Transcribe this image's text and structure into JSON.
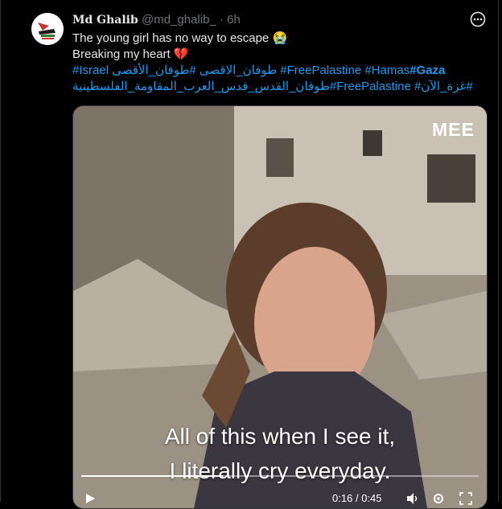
{
  "tweet": {
    "author_name": "Md Ghalib",
    "handle": "@md_ghalib_",
    "separator": "·",
    "time": "6h",
    "line1": "The young girl has no way to escape 😭",
    "line2": "Breaking my heart 💔",
    "hashtags_line1_a": "#طوفان_الأقصى",
    "hashtags_line1_b": "#Israel طوفان_الاقصى",
    "hashtags_line1_c": "#FreePalastine #Hamas",
    "hashtags_line1_d": "#Gaza",
    "hashtags_line2": "طوفان_القدس_قدس_العرب_المقاومة_الفلسطينية#FreePalastine #غزة_الآن#"
  },
  "video": {
    "logo": "MEE",
    "caption_line1": "All of this when I see it,",
    "caption_line2": "I literally cry everyday.",
    "time_current": "0:16",
    "time_sep": "/",
    "time_total": "0:45",
    "progress": 0.356
  },
  "colors": {
    "link": "#1d9bf0",
    "muted": "#71767b",
    "text": "#e7e9ea"
  },
  "icons": [
    "more-icon",
    "play-icon",
    "settings-icon",
    "volume-icon",
    "fullscreen-icon"
  ]
}
